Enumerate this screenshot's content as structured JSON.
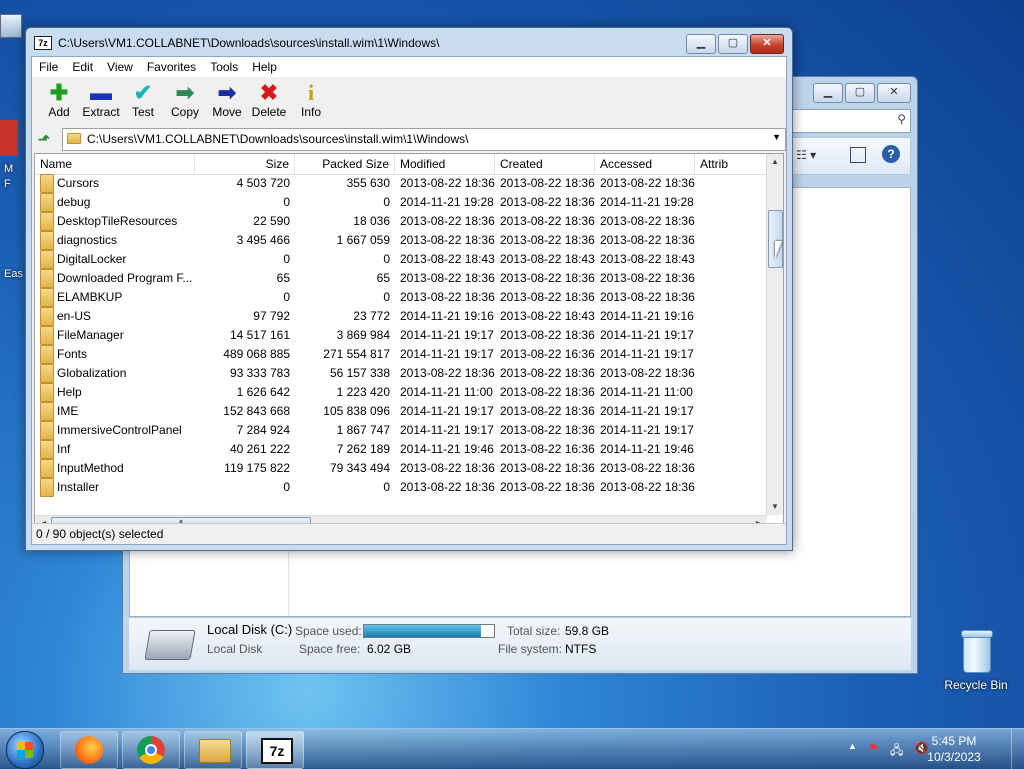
{
  "desktop": {
    "recycle_bin_label": "Recycle Bin",
    "left_icon_fragments": [
      "M",
      "F",
      "Eas"
    ]
  },
  "explorer_bg": {
    "drive_name": "Local Disk (C:)",
    "drive_type": "Local Disk",
    "space_used_label": "Space used:",
    "space_free_label": "Space free:",
    "space_free_value": "6.02 GB",
    "total_size_label": "Total size:",
    "total_size_value": "59.8 GB",
    "file_system_label": "File system:",
    "file_system_value": "NTFS",
    "space_used_fraction": 0.9
  },
  "window": {
    "title": "C:\\Users\\VM1.COLLABNET\\Downloads\\sources\\install.wim\\1\\Windows\\",
    "menu": [
      "File",
      "Edit",
      "View",
      "Favorites",
      "Tools",
      "Help"
    ],
    "toolbar": [
      {
        "name": "add",
        "label": "Add",
        "icon": "plus-icon",
        "color": "#1e9e1e",
        "glyph": "✚"
      },
      {
        "name": "extract",
        "label": "Extract",
        "icon": "minus-icon",
        "color": "#1a35b5",
        "glyph": "▬"
      },
      {
        "name": "test",
        "label": "Test",
        "icon": "check-icon",
        "color": "#19b3b3",
        "glyph": "✔"
      },
      {
        "name": "copy",
        "label": "Copy",
        "icon": "arrow-right-icon",
        "color": "#2e8b57",
        "glyph": "➡"
      },
      {
        "name": "move",
        "label": "Move",
        "icon": "arrow-right-icon",
        "color": "#1a2fa0",
        "glyph": "➡"
      },
      {
        "name": "delete",
        "label": "Delete",
        "icon": "x-icon",
        "color": "#d21c1c",
        "glyph": "✖"
      },
      {
        "name": "info",
        "label": "Info",
        "icon": "info-icon",
        "color": "#c9a100",
        "glyph": "i"
      }
    ],
    "address_path": "C:\\Users\\VM1.COLLABNET\\Downloads\\sources\\install.wim\\1\\Windows\\",
    "status": "0 / 90 object(s) selected"
  },
  "table": {
    "columns": [
      "Name",
      "Size",
      "Packed Size",
      "Modified",
      "Created",
      "Accessed",
      "Attrib"
    ],
    "rows": [
      [
        "Cursors",
        "4 503 720",
        "355 630",
        "2013-08-22 18:36",
        "2013-08-22 18:36",
        "2013-08-22 18:36"
      ],
      [
        "debug",
        "0",
        "0",
        "2014-11-21 19:28",
        "2013-08-22 18:36",
        "2014-11-21 19:28"
      ],
      [
        "DesktopTileResources",
        "22 590",
        "18 036",
        "2013-08-22 18:36",
        "2013-08-22 18:36",
        "2013-08-22 18:36"
      ],
      [
        "diagnostics",
        "3 495 466",
        "1 667 059",
        "2013-08-22 18:36",
        "2013-08-22 18:36",
        "2013-08-22 18:36"
      ],
      [
        "DigitalLocker",
        "0",
        "0",
        "2013-08-22 18:43",
        "2013-08-22 18:43",
        "2013-08-22 18:43"
      ],
      [
        "Downloaded Program F...",
        "65",
        "65",
        "2013-08-22 18:36",
        "2013-08-22 18:36",
        "2013-08-22 18:36"
      ],
      [
        "ELAMBKUP",
        "0",
        "0",
        "2013-08-22 18:36",
        "2013-08-22 18:36",
        "2013-08-22 18:36"
      ],
      [
        "en-US",
        "97 792",
        "23 772",
        "2014-11-21 19:16",
        "2013-08-22 18:43",
        "2014-11-21 19:16"
      ],
      [
        "FileManager",
        "14 517 161",
        "3 869 984",
        "2014-11-21 19:17",
        "2013-08-22 18:36",
        "2014-11-21 19:17"
      ],
      [
        "Fonts",
        "489 068 885",
        "271 554 817",
        "2014-11-21 19:17",
        "2013-08-22 16:36",
        "2014-11-21 19:17"
      ],
      [
        "Globalization",
        "93 333 783",
        "56 157 338",
        "2013-08-22 18:36",
        "2013-08-22 18:36",
        "2013-08-22 18:36"
      ],
      [
        "Help",
        "1 626 642",
        "1 223 420",
        "2014-11-21 11:00",
        "2013-08-22 18:36",
        "2014-11-21 11:00"
      ],
      [
        "IME",
        "152 843 668",
        "105 838 096",
        "2014-11-21 19:17",
        "2013-08-22 18:36",
        "2014-11-21 19:17"
      ],
      [
        "ImmersiveControlPanel",
        "7 284 924",
        "1 867 747",
        "2014-11-21 19:17",
        "2013-08-22 18:36",
        "2014-11-21 19:17"
      ],
      [
        "Inf",
        "40 261 222",
        "7 262 189",
        "2014-11-21 19:46",
        "2013-08-22 16:36",
        "2014-11-21 19:46"
      ],
      [
        "InputMethod",
        "119 175 822",
        "79 343 494",
        "2013-08-22 18:36",
        "2013-08-22 18:36",
        "2013-08-22 18:36"
      ],
      [
        "Installer",
        "0",
        "0",
        "2013-08-22 18:36",
        "2013-08-22 18:36",
        "2013-08-22 18:36"
      ]
    ]
  },
  "taskbar": {
    "time": "5:45 PM",
    "date": "10/3/2023",
    "apps": [
      {
        "name": "firefox",
        "icon": "firefox-icon"
      },
      {
        "name": "chrome",
        "icon": "chrome-icon"
      },
      {
        "name": "file-explorer",
        "icon": "folder-icon"
      },
      {
        "name": "7zip",
        "icon": "7zip-icon",
        "label": "7z"
      }
    ]
  }
}
